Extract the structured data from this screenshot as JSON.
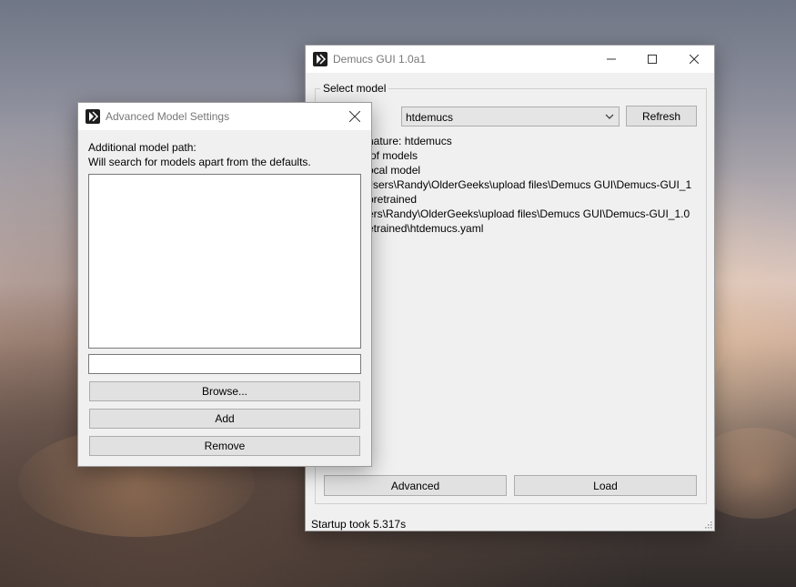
{
  "colors": {
    "window_bg": "#f0f0f0",
    "titlebar_bg": "#ffffff",
    "button_bg": "#e1e1e1",
    "button_border": "#adadad",
    "title_text": "#777777"
  },
  "main_window": {
    "title": "Demucs GUI 1.0a1",
    "icons": {
      "app": "demucs-logo-icon",
      "minimize": "minimize-icon",
      "maximize": "maximize-icon",
      "close": "close-icon"
    },
    "group_title": "Select model",
    "model_select": {
      "value": "htdemucs"
    },
    "refresh_label": "Refresh",
    "info_lines": [
      "nature: htdemucs",
      "of models",
      "ocal model",
      "Jsers\\Randy\\OlderGeeks\\upload files\\Demucs GUI\\Demucs-GUI_1",
      "pretrained",
      "ers\\Randy\\OlderGeeks\\upload files\\Demucs GUI\\Demucs-GUI_1.0",
      "etrained\\htdemucs.yaml"
    ],
    "advanced_label": "Advanced",
    "load_label": "Load",
    "status": "Startup took 5.317s"
  },
  "adv_window": {
    "title": "Advanced Model Settings",
    "icons": {
      "app": "demucs-logo-icon",
      "close": "close-icon"
    },
    "path_label": "Additional model path:",
    "path_hint": "Will search for models apart from the defaults.",
    "path_input": {
      "value": "",
      "placeholder": ""
    },
    "browse_label": "Browse...",
    "add_label": "Add",
    "remove_label": "Remove"
  }
}
